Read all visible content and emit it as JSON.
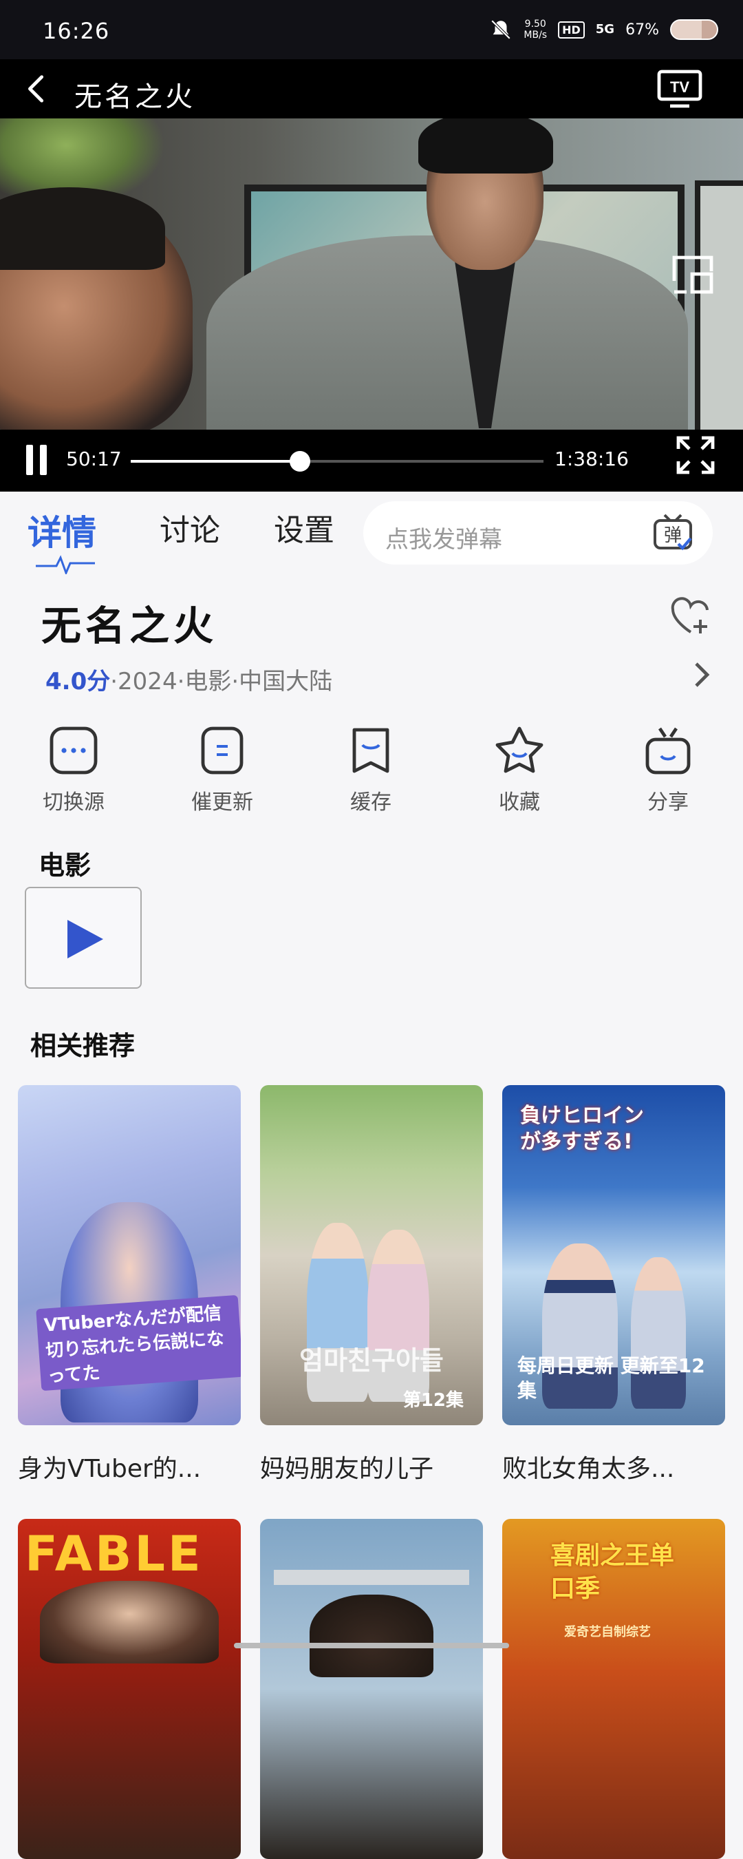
{
  "status_bar": {
    "time": "16:26",
    "net_speed": "9.50\nMB/s",
    "hd": "HD",
    "signal": "5G",
    "battery": "67%"
  },
  "player": {
    "title": "无名之火",
    "current_time": "50:17",
    "duration": "1:38:16",
    "progress": 0.41
  },
  "tabs": [
    {
      "label": "详情"
    },
    {
      "label": "讨论"
    },
    {
      "label": "设置"
    }
  ],
  "danmu": {
    "placeholder": "点我发弹幕",
    "icon_label": "弹"
  },
  "detail": {
    "title": "无名之火",
    "score": "4.0分",
    "meta": "·2024·电影·中国大陆"
  },
  "actions": [
    {
      "label": "切换源",
      "icon": "more-icon"
    },
    {
      "label": "催更新",
      "icon": "list-icon"
    },
    {
      "label": "缓存",
      "icon": "download-icon"
    },
    {
      "label": "收藏",
      "icon": "star-icon"
    },
    {
      "label": "分享",
      "icon": "share-icon"
    }
  ],
  "section_movie": "电影",
  "section_related": "相关推荐",
  "related": [
    {
      "title": "身为VTuber的...",
      "poster_text": "VTuberなんだが配信切り忘れたら伝説になってた"
    },
    {
      "title": "妈妈朋友的儿子",
      "poster_text": "第12集"
    },
    {
      "title": "败北女角太多...",
      "poster_text": "每周日更新 更新至12集",
      "logo_text": "負けヒロインが多すぎる!"
    },
    {
      "title": "",
      "poster_text": "FABLE"
    },
    {
      "title": "",
      "poster_text": ""
    },
    {
      "title": "",
      "poster_text": "喜剧之王单口季",
      "subtext": "爱奇艺自制综艺"
    }
  ],
  "colors": {
    "accent": "#3366dd",
    "background": "#f6f6f8"
  }
}
